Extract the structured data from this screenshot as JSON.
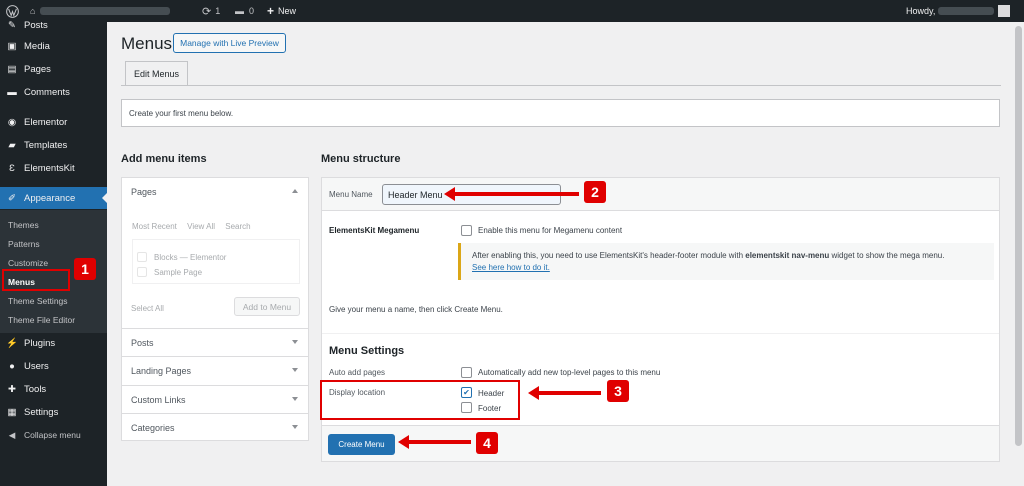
{
  "adminbar": {
    "new_label": "New",
    "updates_count": "1",
    "comments_count": "0",
    "howdy": "Howdy,"
  },
  "sidebar": {
    "items": [
      {
        "label": "Posts",
        "icon": "pin-icon"
      },
      {
        "label": "Media",
        "icon": "media-icon"
      },
      {
        "label": "Pages",
        "icon": "pages-icon"
      },
      {
        "label": "Comments",
        "icon": "comments-icon"
      },
      {
        "label": "Elementor",
        "icon": "elementor-icon"
      },
      {
        "label": "Templates",
        "icon": "folder-icon"
      },
      {
        "label": "ElementsKit",
        "icon": "elementskit-icon"
      },
      {
        "label": "Appearance",
        "icon": "brush-icon"
      },
      {
        "label": "Plugins",
        "icon": "plug-icon"
      },
      {
        "label": "Users",
        "icon": "users-icon"
      },
      {
        "label": "Tools",
        "icon": "wrench-icon"
      },
      {
        "label": "Settings",
        "icon": "settings-icon"
      },
      {
        "label": "Collapse menu",
        "icon": "collapse-icon"
      }
    ],
    "submenu": [
      "Themes",
      "Patterns",
      "Customize",
      "Menus",
      "Theme Settings",
      "Theme File Editor"
    ]
  },
  "page": {
    "title": "Menus",
    "live_preview_button": "Manage with Live Preview",
    "tab": "Edit Menus",
    "notice": "Create your first menu below."
  },
  "left": {
    "heading": "Add menu items",
    "pages_label": "Pages",
    "tabs": [
      "Most Recent",
      "View All",
      "Search"
    ],
    "options": [
      "Blocks — Elementor",
      "Sample Page"
    ],
    "select_all": "Select All",
    "add_button": "Add to Menu",
    "accordions": [
      "Posts",
      "Landing Pages",
      "Custom Links",
      "Categories"
    ]
  },
  "right": {
    "heading": "Menu structure",
    "menu_name_label": "Menu Name",
    "menu_name_value": "Header Menu",
    "megamenu_label": "ElementsKit Megamenu",
    "megamenu_checkbox": "Enable this menu for Megamenu content",
    "warn_text_1": "After enabling this, you need to use ElementsKit's header-footer module with ",
    "warn_bold": "elementskit nav-menu",
    "warn_text_2": " widget to show the mega menu.",
    "warn_link": "See here how to do it.",
    "give_name": "Give your menu a name, then click Create Menu.",
    "settings_heading": "Menu Settings",
    "auto_add_label": "Auto add pages",
    "auto_add_text": "Automatically add new top-level pages to this menu",
    "display_label": "Display location",
    "locations": [
      "Header",
      "Footer"
    ],
    "create_button": "Create Menu"
  },
  "annotations": [
    "1",
    "2",
    "3",
    "4"
  ],
  "colors": {
    "accent": "#2271b1",
    "annotation_red": "#e00000",
    "sidebar_bg": "#1d2327"
  }
}
